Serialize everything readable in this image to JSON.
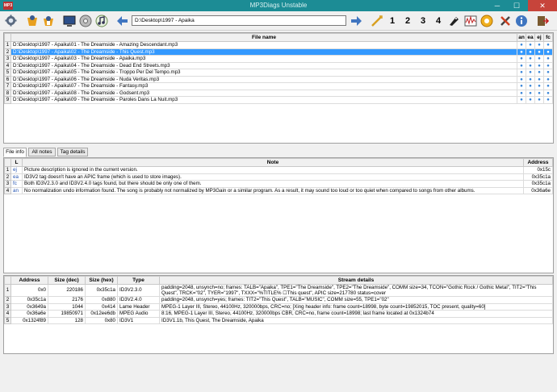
{
  "window": {
    "title": "MP3Diags Unstable",
    "app_icon": "MP3",
    "minimize": "─",
    "maximize": "☐",
    "close": "✕"
  },
  "toolbar": {
    "path": "D:\\Desktop\\1997 - Apaika",
    "transform_labels": [
      "1",
      "2",
      "3",
      "4"
    ]
  },
  "files": {
    "headers": [
      "",
      "File name",
      "an",
      "ea",
      "ej",
      "fc"
    ],
    "rows": [
      {
        "n": "1",
        "name": "D:\\Desktop\\1997 - Apaika\\01 - The Dreamside - Amazing Descendant.mp3",
        "flags": [
          "●",
          "●",
          "●",
          "●"
        ],
        "selected": false
      },
      {
        "n": "2",
        "name": "D:\\Desktop\\1997 - Apaika\\02 - The Dreamside - This Quest.mp3",
        "flags": [
          "●",
          "●",
          "●",
          "●"
        ],
        "selected": true
      },
      {
        "n": "3",
        "name": "D:\\Desktop\\1997 - Apaika\\03 - The Dreamside - Apaika.mp3",
        "flags": [
          "●",
          "●",
          "●",
          "●"
        ],
        "selected": false
      },
      {
        "n": "4",
        "name": "D:\\Desktop\\1997 - Apaika\\04 - The Dreamside - Dead End Streets.mp3",
        "flags": [
          "●",
          "●",
          "●",
          "●"
        ],
        "selected": false
      },
      {
        "n": "5",
        "name": "D:\\Desktop\\1997 - Apaika\\05 - The Dreamside - Troppo Per Del Tempo.mp3",
        "flags": [
          "●",
          "●",
          "●",
          "●"
        ],
        "selected": false
      },
      {
        "n": "6",
        "name": "D:\\Desktop\\1997 - Apaika\\06 - The Dreamside - Nuda Veritas.mp3",
        "flags": [
          "●",
          "●",
          "●",
          "●"
        ],
        "selected": false
      },
      {
        "n": "7",
        "name": "D:\\Desktop\\1997 - Apaika\\07 - The Dreamside - Fantasy.mp3",
        "flags": [
          "●",
          "●",
          "●",
          "●"
        ],
        "selected": false
      },
      {
        "n": "8",
        "name": "D:\\Desktop\\1997 - Apaika\\08 - The Dreamside - Godsent.mp3",
        "flags": [
          "●",
          "●",
          "●",
          "●"
        ],
        "selected": false
      },
      {
        "n": "9",
        "name": "D:\\Desktop\\1997 - Apaika\\09 - The Dreamside - Paroles Dans La Nuit.mp3",
        "flags": [
          "●",
          "●",
          "●",
          "●"
        ],
        "selected": false
      }
    ]
  },
  "tabs": [
    "File info",
    "All notes",
    "Tag details"
  ],
  "notes": {
    "headers": [
      "",
      "L",
      "Note",
      "Address"
    ],
    "rows": [
      {
        "n": "1",
        "l": "ej",
        "note": "Picture description is ignored in the current version.",
        "addr": "0x15c"
      },
      {
        "n": "2",
        "l": "ea",
        "note": "ID3V2 tag doesn't have an APIC frame (which is used to store images).",
        "addr": "0x35c1a"
      },
      {
        "n": "3",
        "l": "fc",
        "note": "Both ID3V2.3.0 and ID3V2.4.0 tags found, but there should be only one of them.",
        "addr": "0x35c1a"
      },
      {
        "n": "4",
        "l": "an",
        "note": "No normalization undo information found. The song is probably not normalized by MP3Gain or a similar program. As a result, it may sound too loud or too quiet when compared to songs from other albums.",
        "addr": "0x36a6e"
      }
    ]
  },
  "streams": {
    "headers": [
      "",
      "Address",
      "Size (dec)",
      "Size (hex)",
      "Type",
      "Stream details"
    ],
    "rows": [
      {
        "n": "1",
        "addr": "0x0",
        "dec": "220186",
        "hex": "0x35c1a",
        "type": "ID3V2.3.0",
        "details": "padding=2048, unsynch=no; frames: TALB=\"Apaika\", TPE1=\"The Dreamside\", TPE2=\"The Dreamside\", COMM size=34, TCON=\"Gothic Rock / Gothic Metal\", TIT2=\"This Quest\", TRCK=\"02\", TYER=\"1997\", TXXX=\"%TITLE% ☐This quest\", APIC size=217780 status=cover"
      },
      {
        "n": "2",
        "addr": "0x35c1a",
        "dec": "2176",
        "hex": "0x880",
        "type": "ID3V2.4.0",
        "details": "padding=2048, unsynch=yes; frames: TIT2=\"This Quest\", TALB=\"MUSIC\", COMM size=55, TPE1=\"02\""
      },
      {
        "n": "3",
        "addr": "0x3649a",
        "dec": "1044",
        "hex": "0x414",
        "type": "Lame Header",
        "details": "MPEG-1 Layer III, Stereo, 44100Hz, 320000bps, CRC=no; [Xing header info: frame count=18998, byte count=19852015, TOC present, quality=60]"
      },
      {
        "n": "4",
        "addr": "0x36a6e",
        "dec": "19850971",
        "hex": "0x12ee6db",
        "type": "MPEG Audio",
        "details": "8:16, MPEG-1 Layer III, Stereo, 44100Hz, 320000bps CBR, CRC=no, frame count=18998; last frame located at 0x1324b74"
      },
      {
        "n": "5",
        "addr": "0x1324f89",
        "dec": "128",
        "hex": "0x80",
        "type": "ID3V1",
        "details": "ID3V1.1b, This Quest, The Dreamside, Apaika"
      }
    ]
  }
}
